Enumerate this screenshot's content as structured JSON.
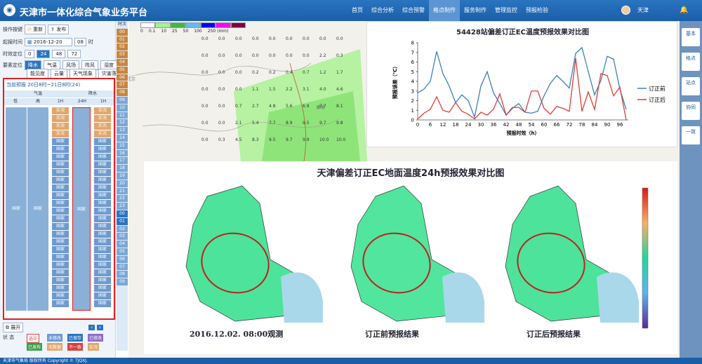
{
  "app": {
    "title": "天津市一体化综合气象业务平台",
    "user": "天津"
  },
  "nav": [
    "首页",
    "综合分析",
    "综合预警",
    "格点制作",
    "服务制作",
    "管理监控",
    "预报检验"
  ],
  "nav_active": 3,
  "left": {
    "op_label": "操作按键",
    "reset": "重新",
    "publish": "发布",
    "start_label": "起报时间",
    "date": "2016-12-20",
    "hour": "08",
    "hour_unit": "时",
    "dur_label": "时效定位",
    "durs": [
      "0",
      "24",
      "48",
      "72"
    ],
    "dur_active": 1,
    "elem_label": "要素定位",
    "elems_row1": [
      "降水",
      "气温",
      "风场",
      "阵风",
      "湿度"
    ],
    "elems_row2": [
      "能见度",
      "云量",
      "天气现象",
      "灾害落区"
    ],
    "fb_title": "当前预报  20日8时~21日8时(24)",
    "h_temp": "气温",
    "h_rain": "降水",
    "h_low": "低",
    "h_high": "高",
    "h_1h": "1H",
    "h_24h": "24H",
    "h_1h2": "1H",
    "big": "国家",
    "cell_r": "实况",
    "cell_b": "国家",
    "expand": "展开",
    "status_label": "状  态",
    "statuses": [
      "选中",
      "未修改",
      "已保存",
      "已修改",
      "已发布",
      "无数据",
      "不一致",
      "实况"
    ]
  },
  "timecol": [
    "时次",
    "00",
    "01",
    "02",
    "03",
    "04",
    "05",
    "06",
    "07",
    "08",
    "09",
    "10",
    "11",
    "12",
    "13",
    "14",
    "15",
    "16",
    "17",
    "18",
    "19",
    "20",
    "21",
    "22",
    "23",
    "00",
    "01",
    "02",
    "03",
    "04",
    "05",
    "06",
    "07",
    "08",
    "09"
  ],
  "legend": {
    "labels": [
      "0",
      "0.1",
      "10",
      "25",
      "50",
      "100",
      "250 (mm)"
    ],
    "colors": [
      "#ffffff",
      "#a6f28f",
      "#3dba3d",
      "#61b8ff",
      "#0000ff",
      "#fa00fa",
      "#800040"
    ]
  },
  "gridnums": [
    [
      "0.0",
      "0.0",
      "0.0",
      "0.0",
      "0.0",
      "0.0",
      "0.0",
      "0.0",
      "0.0"
    ],
    [
      "0.0",
      "0.0",
      "0.0",
      "0.0",
      "0.0",
      "0.0",
      "0.0",
      "2.2",
      "0.3"
    ],
    [
      "0.0",
      "0.0",
      "0.0",
      "0.2",
      "0.2",
      "0.4",
      "0.7",
      "1.2",
      "1.7"
    ],
    [
      "0.0",
      "0.0",
      "0.0",
      "1.1",
      "1.5",
      "2.2",
      "3.1",
      "4.0",
      "4.6"
    ],
    [
      "0.0",
      "0.0",
      "0.7",
      "2.7",
      "4.8",
      "5.6",
      "6.9",
      "7.7",
      "8.1"
    ],
    [
      "0.0",
      "0.0",
      "2.1",
      "5.4",
      "7.7",
      "8.9",
      "9.5",
      "9.7",
      "9.8"
    ],
    [
      "0.0",
      "0.3",
      "4.5",
      "8.3",
      "9.5",
      "9.7",
      "9.9",
      "10.0",
      "10.0"
    ]
  ],
  "maplabels": [
    "北京",
    "廊坊",
    "保定"
  ],
  "chart1": {
    "title": "54428站偏差订正EC温度预报效果对比图",
    "xlabel": "预报时效（h）",
    "ylabel": "预报误差（℃）"
  },
  "chart2": {
    "title": "天津偏差订正EC地面温度24h预报效果对比图",
    "labels": [
      "2016.12.02. 08:00观测",
      "订正前预报结果",
      "订正后预报结果"
    ]
  },
  "chart_data": {
    "type": "line",
    "title": "54428站偏差订正EC温度预报效果对比图",
    "xlabel": "预报时效（h）",
    "ylabel": "预报误差（℃）",
    "ylim": [
      0,
      8
    ],
    "x": [
      0,
      3,
      6,
      9,
      12,
      15,
      18,
      21,
      24,
      27,
      30,
      33,
      36,
      39,
      42,
      45,
      48,
      51,
      54,
      57,
      60,
      63,
      66,
      69,
      72,
      75,
      78,
      81,
      84,
      87,
      90,
      93,
      96,
      99
    ],
    "series": [
      {
        "name": "订正前",
        "color": "#3a7fc4",
        "values": [
          2.8,
          3.2,
          4.0,
          7.1,
          4.8,
          3.5,
          1.8,
          2.6,
          2.0,
          0.3,
          3.5,
          5.0,
          2.8,
          1.7,
          0.5,
          1.2,
          1.7,
          0.8,
          0.7,
          0.9,
          2.5,
          3.8,
          4.6,
          4.0,
          3.3,
          6.9,
          7.5,
          5.0,
          2.6,
          4.1,
          6.6,
          6.3,
          3.2,
          1.1
        ],
        "color_note": ""
      },
      {
        "name": "订正后",
        "color": "#d9403a",
        "values": [
          0.1,
          0.7,
          1.1,
          2.4,
          1.0,
          0.8,
          1.8,
          0.9,
          0.6,
          0.1,
          0.8,
          0.5,
          1.1,
          2.7,
          0.5,
          1.3,
          1.3,
          0.8,
          3.0,
          3.0,
          1.2,
          0.6,
          1.4,
          1.2,
          0.9,
          6.4,
          0.9,
          2.9,
          1.1,
          4.8,
          4.6,
          2.5,
          3.4,
          0.0
        ]
      }
    ],
    "xticks": [
      0,
      6,
      12,
      18,
      24,
      30,
      36,
      42,
      48,
      54,
      60,
      66,
      72,
      78,
      84,
      90,
      96
    ]
  },
  "sidebtns": [
    "基本",
    "格点",
    "站点",
    "协同",
    "一致"
  ],
  "footer": "天津市气象局 版权所有 Copyright © TJQXJ."
}
